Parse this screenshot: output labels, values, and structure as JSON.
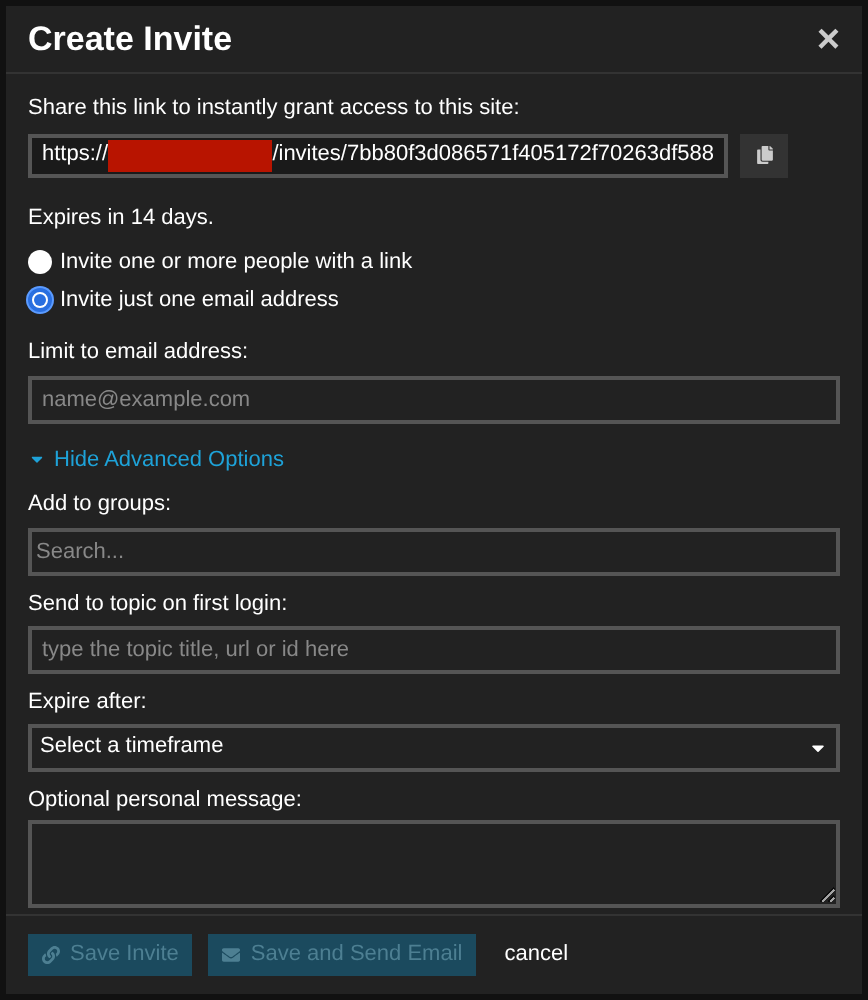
{
  "dialog": {
    "title": "Create Invite",
    "close": "×"
  },
  "share": {
    "label": "Share this link to instantly grant access to this site:",
    "link_start": "https://",
    "redacted": true,
    "link_end": "/invites/7bb80f3d086571f405172f70263df588"
  },
  "expires_note": "Expires in 14 days.",
  "invite_mode": [
    {
      "label": "Invite one or more people with a link",
      "selected": false
    },
    {
      "label": "Invite just one email address",
      "selected": true
    }
  ],
  "fields": [
    {
      "kind": "input",
      "label": "Limit to email address:",
      "placeholder": "name@example.com"
    }
  ],
  "advanced_toggle": {
    "label": "Hide Advanced Options",
    "expanded": true
  },
  "advanced_fields": [
    {
      "kind": "input",
      "label": "Add to groups:",
      "placeholder": "Search..."
    },
    {
      "kind": "input",
      "label": "Send to topic on first login:",
      "placeholder": "type the topic title, url or id here"
    },
    {
      "kind": "select",
      "label": "Expire after:",
      "value": "Select a timeframe"
    },
    {
      "kind": "textarea",
      "label": "Optional personal message:"
    }
  ],
  "buttons": [
    {
      "kind": "link",
      "label": "Save Invite",
      "disabled": true
    },
    {
      "kind": "email",
      "label": "Save and Send Email",
      "disabled": true
    },
    {
      "kind": "cancel",
      "label": "cancel",
      "disabled": false
    }
  ]
}
